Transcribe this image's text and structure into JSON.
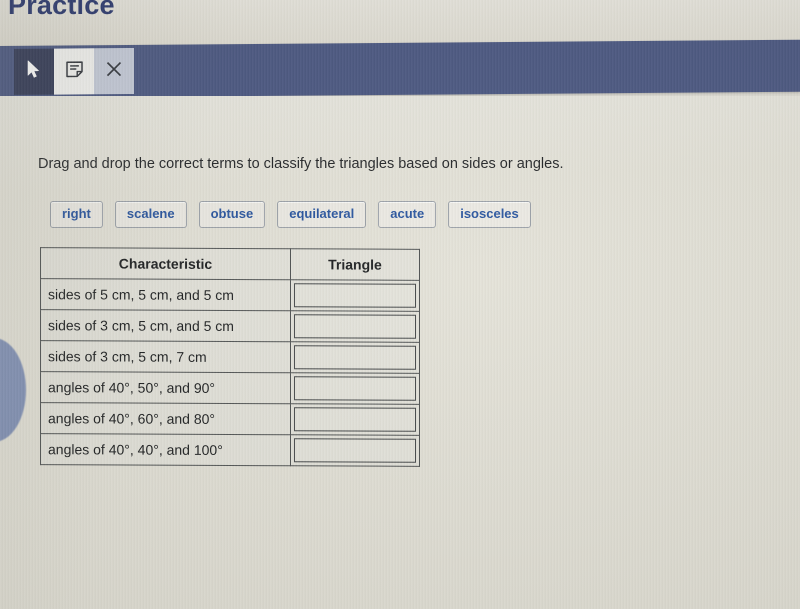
{
  "page": {
    "title": "Practice"
  },
  "toolbar": {
    "buttons": [
      {
        "name": "pointer-tool",
        "icon": "cursor-arrow-icon",
        "label": "Pointer tool",
        "state": "inactive"
      },
      {
        "name": "annotate-tool",
        "icon": "sticky-note-icon",
        "label": "Annotate tool",
        "state": "active"
      },
      {
        "name": "close-tool",
        "icon": "close-x-icon",
        "label": "Close",
        "state": "inactive"
      }
    ],
    "background_color": "#46537f"
  },
  "main": {
    "instruction": "Drag and drop the correct terms to classify the triangles based on sides or angles.",
    "terms": [
      {
        "label": "right"
      },
      {
        "label": "scalene"
      },
      {
        "label": "obtuse"
      },
      {
        "label": "equilateral"
      },
      {
        "label": "acute"
      },
      {
        "label": "isosceles"
      }
    ],
    "term_text_color": "#23509d",
    "table": {
      "headers": [
        "Characteristic",
        "Triangle"
      ],
      "rows": [
        {
          "characteristic": "sides of 5 cm, 5 cm, and 5 cm",
          "triangle": ""
        },
        {
          "characteristic": "sides of 3 cm, 5 cm, and 5 cm",
          "triangle": ""
        },
        {
          "characteristic": "sides of 3 cm, 5 cm, 7 cm",
          "triangle": ""
        },
        {
          "characteristic": "angles of 40°, 50°, and 90°",
          "triangle": ""
        },
        {
          "characteristic": "angles of 40°, 60°, and 80°",
          "triangle": ""
        },
        {
          "characteristic": "angles of 40°, 40°, and 100°",
          "triangle": ""
        }
      ]
    }
  }
}
